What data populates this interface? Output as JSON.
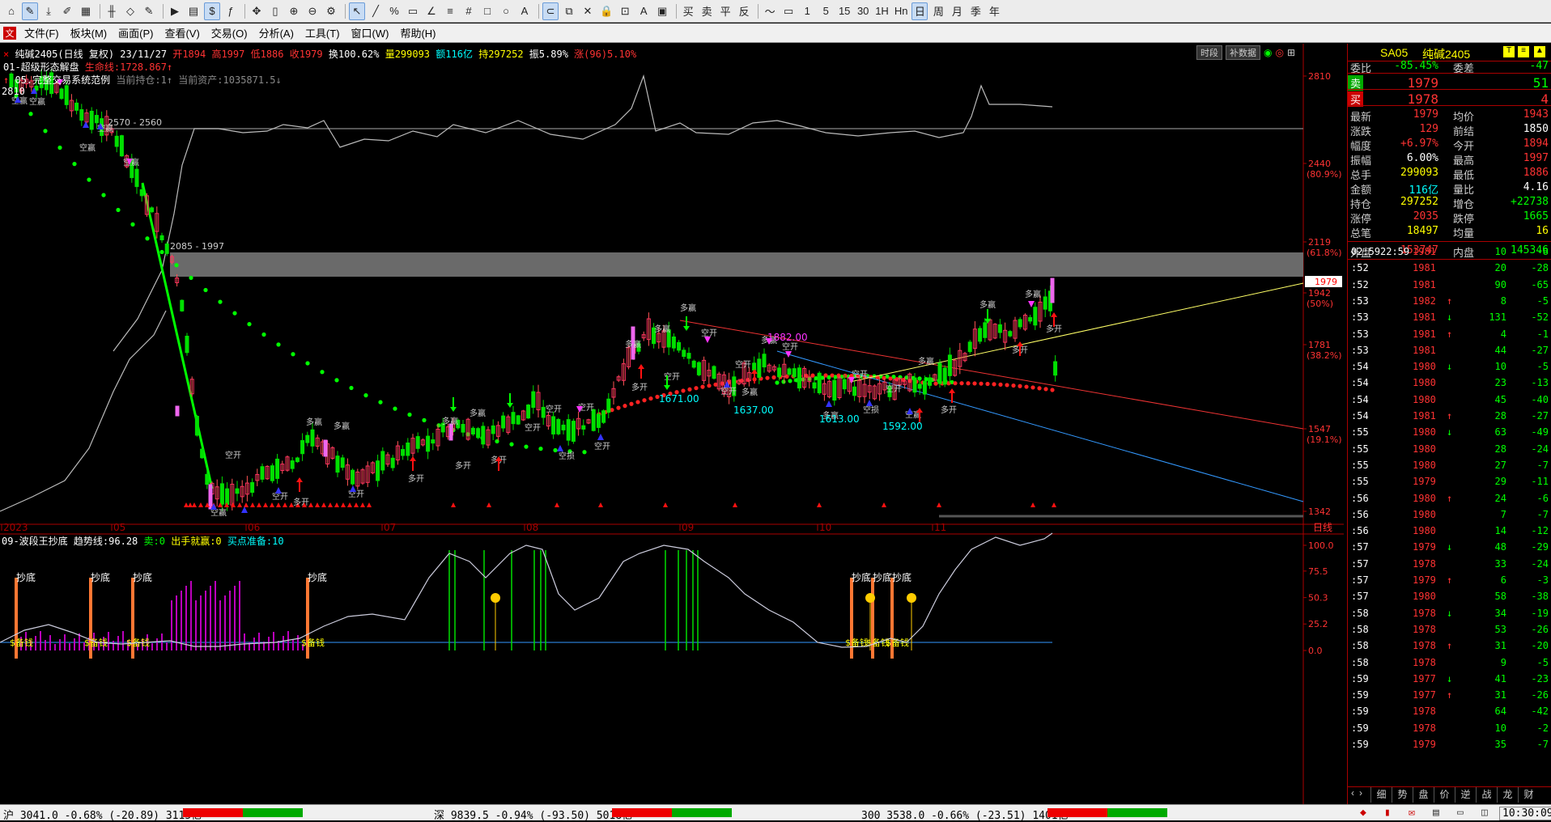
{
  "menu": [
    "文件(F)",
    "板块(M)",
    "画面(P)",
    "查看(V)",
    "交易(O)",
    "分析(A)",
    "工具(T)",
    "窗口(W)",
    "帮助(H)"
  ],
  "toolbar": {
    "cycles": [
      "1",
      "5",
      "15",
      "30",
      "1H",
      "Hn",
      "日",
      "周",
      "月",
      "季",
      "年"
    ],
    "trade_labels": [
      "买",
      "卖",
      "平",
      "反"
    ]
  },
  "header": {
    "symbol": "纯碱2405(日线 复权) 23/11/27",
    "open": "开1894",
    "high": "高1997",
    "low": "低1886",
    "close": "收1979",
    "turnover": "换100.62%",
    "volume": "量299093",
    "amount": "额116亿",
    "oi": "持297252",
    "amplitude": "振5.89%",
    "change": "涨(96)5.10%",
    "line2_name": "01-超级形态解盘",
    "line2_value": "生命线:1728.867↑",
    "line3_name": "05.完整交易系统范例",
    "line3_value": "当前持仓:1↑ 当前资产:1035871.5↓",
    "btn_timeshare": "时段",
    "btn_fill": "补数据",
    "top_left_label": "2810"
  },
  "price_axis": [
    {
      "label": "2810",
      "pct": ""
    },
    {
      "label": "2440",
      "pct": "(80.9%)"
    },
    {
      "label": "2119",
      "pct": "(61.8%)"
    },
    {
      "label": "1942",
      "pct": "(50%)"
    },
    {
      "label": "1781",
      "pct": "(38.2%)"
    },
    {
      "label": "1547",
      "pct": "(19.1%)"
    },
    {
      "label": "1342",
      "pct": ""
    }
  ],
  "last_price_tag": "1979",
  "time_axis": [
    "2023",
    "05",
    "06",
    "07",
    "08",
    "09",
    "10",
    "11"
  ],
  "period_label": "日线",
  "annotations": {
    "box1": "2570 - 2560",
    "box2": "2085 - 1997",
    "low1": "1671.00",
    "low2": "1637.00",
    "low3": "1613.00",
    "low4": "1592.00",
    "mid": "1882.00",
    "buy_open": "多开",
    "sell_open": "空开",
    "buy_win": "多赢",
    "sell_win": "空赢",
    "stop_loss": "空损"
  },
  "indicator": {
    "name": "09-波段王抄底",
    "trend": "趋势线:96.28",
    "sell": "卖:0",
    "win": "出手就赢:0",
    "buy_prep": "买点准备:10",
    "axis": [
      "100.0",
      "75.5",
      "50.3",
      "25.2",
      "0.0"
    ],
    "bottom_label": "抄底",
    "prep_label": "$备钱"
  },
  "quote": {
    "code": "SA05",
    "name": "纯碱2405",
    "rows": [
      {
        "l1": "委比",
        "v1": "-85.45%",
        "l2": "委差",
        "v2": "-47"
      },
      {
        "l1": "卖",
        "v1": "1979",
        "l2": "",
        "v2": "51"
      },
      {
        "l1": "买",
        "v1": "1978",
        "l2": "",
        "v2": "4"
      },
      {
        "l1": "最新",
        "v1": "1979",
        "l2": "均价",
        "v2": "1943"
      },
      {
        "l1": "涨跌",
        "v1": "129",
        "l2": "前结",
        "v2": "1850"
      },
      {
        "l1": "幅度",
        "v1": "+6.97%",
        "l2": "今开",
        "v2": "1894"
      },
      {
        "l1": "振幅",
        "v1": "6.00%",
        "l2": "最高",
        "v2": "1997"
      },
      {
        "l1": "总手",
        "v1": "299093",
        "l2": "最低",
        "v2": "1886"
      },
      {
        "l1": "金额",
        "v1": "116亿",
        "l2": "量比",
        "v2": "4.16"
      },
      {
        "l1": "持仓",
        "v1": "297252",
        "l2": "增仓",
        "v2": "+22738"
      },
      {
        "l1": "涨停",
        "v1": "2035",
        "l2": "跌停",
        "v2": "1665"
      },
      {
        "l1": "总笔",
        "v1": "18497",
        "l2": "均量",
        "v2": "16"
      },
      {
        "l1": "外盘",
        "v1": "153747",
        "l2": "内盘",
        "v2": "145346"
      }
    ],
    "ticks": [
      {
        "t": "02:59",
        "t2": "22:59",
        "p": "1981",
        "a": "",
        "v": "10",
        "d": "-8"
      },
      {
        "t": ":52",
        "p": "1981",
        "a": "",
        "v": "20",
        "d": "-28"
      },
      {
        "t": ":52",
        "p": "1981",
        "a": "",
        "v": "90",
        "d": "-65"
      },
      {
        "t": ":53",
        "p": "1982",
        "a": "↑",
        "v": "8",
        "d": "-5"
      },
      {
        "t": ":53",
        "p": "1981",
        "a": "↓",
        "v": "131",
        "d": "-52"
      },
      {
        "t": ":53",
        "p": "1981",
        "a": "↑",
        "v": "4",
        "d": "-1"
      },
      {
        "t": ":53",
        "p": "1981",
        "a": "",
        "v": "44",
        "d": "-27"
      },
      {
        "t": ":54",
        "p": "1980",
        "a": "↓",
        "v": "10",
        "d": "-5"
      },
      {
        "t": ":54",
        "p": "1980",
        "a": "",
        "v": "23",
        "d": "-13"
      },
      {
        "t": ":54",
        "p": "1980",
        "a": "",
        "v": "45",
        "d": "-40"
      },
      {
        "t": ":54",
        "p": "1981",
        "a": "↑",
        "v": "28",
        "d": "-27"
      },
      {
        "t": ":55",
        "p": "1980",
        "a": "↓",
        "v": "63",
        "d": "-49"
      },
      {
        "t": ":55",
        "p": "1980",
        "a": "",
        "v": "28",
        "d": "-24"
      },
      {
        "t": ":55",
        "p": "1980",
        "a": "",
        "v": "27",
        "d": "-7"
      },
      {
        "t": ":55",
        "p": "1979",
        "a": "",
        "v": "29",
        "d": "-11"
      },
      {
        "t": ":56",
        "p": "1980",
        "a": "↑",
        "v": "24",
        "d": "-6"
      },
      {
        "t": ":56",
        "p": "1980",
        "a": "",
        "v": "7",
        "d": "-7"
      },
      {
        "t": ":56",
        "p": "1980",
        "a": "",
        "v": "14",
        "d": "-12"
      },
      {
        "t": ":57",
        "p": "1979",
        "a": "↓",
        "v": "48",
        "d": "-29"
      },
      {
        "t": ":57",
        "p": "1978",
        "a": "",
        "v": "33",
        "d": "-24"
      },
      {
        "t": ":57",
        "p": "1979",
        "a": "↑",
        "v": "6",
        "d": "-3"
      },
      {
        "t": ":57",
        "p": "1980",
        "a": "",
        "v": "58",
        "d": "-38"
      },
      {
        "t": ":58",
        "p": "1978",
        "a": "↓",
        "v": "34",
        "d": "-19"
      },
      {
        "t": ":58",
        "p": "1978",
        "a": "",
        "v": "53",
        "d": "-26"
      },
      {
        "t": ":58",
        "p": "1978",
        "a": "↑",
        "v": "31",
        "d": "-20"
      },
      {
        "t": ":58",
        "p": "1978",
        "a": "",
        "v": "9",
        "d": "-5"
      },
      {
        "t": ":59",
        "p": "1977",
        "a": "↓",
        "v": "41",
        "d": "-23"
      },
      {
        "t": ":59",
        "p": "1977",
        "a": "↑",
        "v": "31",
        "d": "-26"
      },
      {
        "t": ":59",
        "p": "1978",
        "a": "",
        "v": "64",
        "d": "-42"
      },
      {
        "t": ":59",
        "p": "1978",
        "a": "",
        "v": "10",
        "d": "-2"
      },
      {
        "t": ":59",
        "p": "1979",
        "a": "",
        "v": "35",
        "d": "-7"
      }
    ],
    "tabs": [
      "细",
      "势",
      "盘",
      "价",
      "逆",
      "战",
      "龙",
      "财"
    ]
  },
  "status": {
    "sh": "沪 3041.0 -0.68% (-20.89) 3115亿",
    "sz": "深 9839.5 -0.94% (-93.50) 5018亿",
    "i300": "300 3538.0 -0.66% (-23.51) 1401亿",
    "time": "10:30:09"
  },
  "colors": {
    "up": "#ff3030",
    "down": "#00e000",
    "accent": "#ffff00",
    "cyan": "#00ffff",
    "magenta": "#ff40ff"
  }
}
